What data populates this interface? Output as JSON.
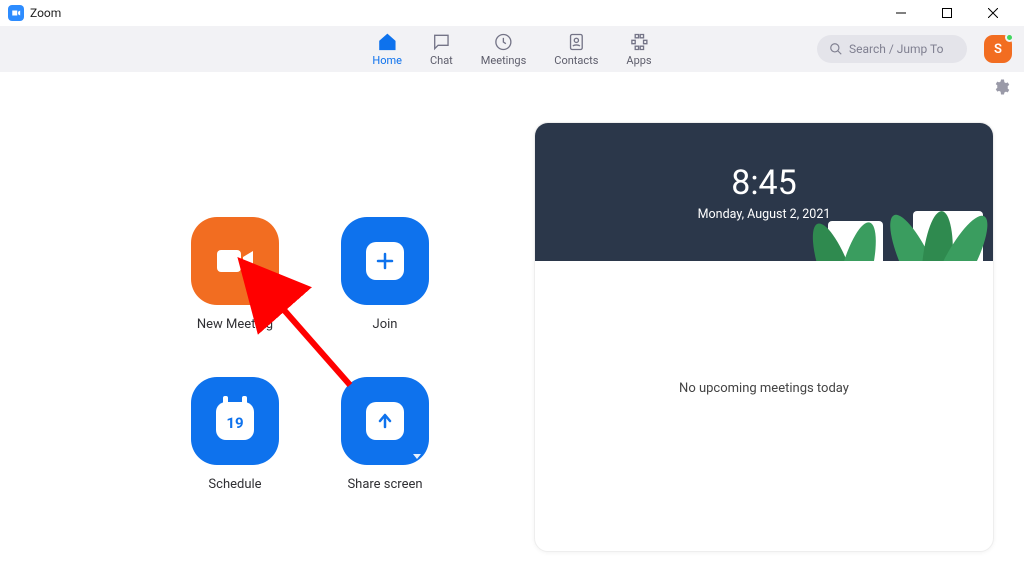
{
  "titlebar": {
    "app_name": "Zoom"
  },
  "nav": {
    "tabs": [
      {
        "id": "home",
        "label": "Home",
        "active": true
      },
      {
        "id": "chat",
        "label": "Chat",
        "active": false
      },
      {
        "id": "meetings",
        "label": "Meetings",
        "active": false
      },
      {
        "id": "contacts",
        "label": "Contacts",
        "active": false
      },
      {
        "id": "apps",
        "label": "Apps",
        "active": false
      }
    ],
    "search_placeholder": "Search / Jump To",
    "avatar_initial": "S"
  },
  "actions": {
    "new_meeting": "New Meeting",
    "join": "Join",
    "schedule": "Schedule",
    "schedule_day": "19",
    "share_screen": "Share screen"
  },
  "info": {
    "time": "8:45",
    "date": "Monday, August 2, 2021",
    "empty_msg": "No upcoming meetings today"
  }
}
